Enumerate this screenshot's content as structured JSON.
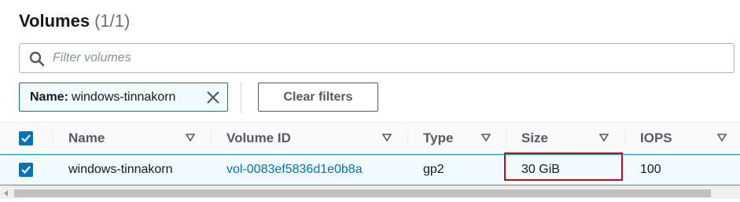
{
  "header": {
    "title": "Volumes",
    "count": "(1/1)"
  },
  "search": {
    "placeholder": "Filter volumes",
    "value": ""
  },
  "filter_token": {
    "key": "Name:",
    "value": "windows-tinnakorn"
  },
  "actions": {
    "clear_filters_label": "Clear filters"
  },
  "table": {
    "columns": [
      {
        "label": "Name"
      },
      {
        "label": "Volume ID"
      },
      {
        "label": "Type"
      },
      {
        "label": "Size"
      },
      {
        "label": "IOPS"
      }
    ],
    "rows": [
      {
        "selected": true,
        "name": "windows-tinnakorn",
        "volume_id": "vol-0083ef5836d1e0b8a",
        "type": "gp2",
        "size": "30 GiB",
        "iops": "100"
      }
    ]
  },
  "colors": {
    "accent": "#0073bb",
    "highlight_border": "#d0021b",
    "selected_row_bg": "#f1faff"
  },
  "icons": {
    "search": "search-icon",
    "dismiss": "close-icon",
    "sort": "sort-down-icon",
    "check": "checkmark-icon"
  }
}
